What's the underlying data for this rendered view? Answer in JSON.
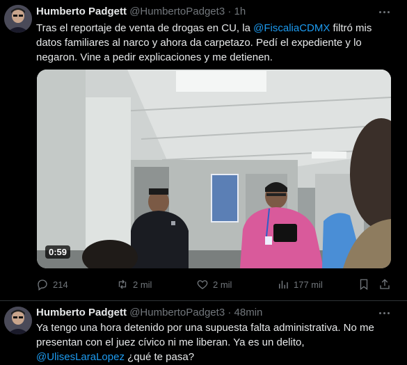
{
  "colors": {
    "background": "#000000",
    "text": "#e7e9ea",
    "muted": "#71767b",
    "link": "#1d9bf0",
    "divider": "#2f3336"
  },
  "tweets": [
    {
      "name": "Humberto Padgett",
      "handle": "@HumbertoPadget3",
      "separator": "·",
      "time": "1h",
      "text_1": "Tras el reportaje de venta de drogas en CU, la ",
      "mention_1": "@FiscaliaCDMX",
      "text_2": " filtró mis datos familiares al narco y ahora da carpetazo. Pedí el expediente y lo negaron. Vine a pedir explicaciones y me detienen.",
      "video": {
        "duration": "0:59"
      },
      "actions": {
        "replies": "214",
        "reposts": "2 mil",
        "likes": "2 mil",
        "views": "177 mil"
      },
      "icons": [
        "reply-icon",
        "repost-icon",
        "like-icon",
        "views-icon",
        "bookmark-icon",
        "share-icon",
        "more-icon"
      ]
    },
    {
      "name": "Humberto Padgett",
      "handle": "@HumbertoPadget3",
      "separator": "·",
      "time": "48min",
      "text_1": "Ya tengo una hora detenido por una supuesta falta administrativa. No me presentan con el juez cívico ni me liberan. Ya es un delito, ",
      "mention_1": "@UlisesLaraLopez",
      "text_2": " ¿qué te pasa?"
    }
  ]
}
